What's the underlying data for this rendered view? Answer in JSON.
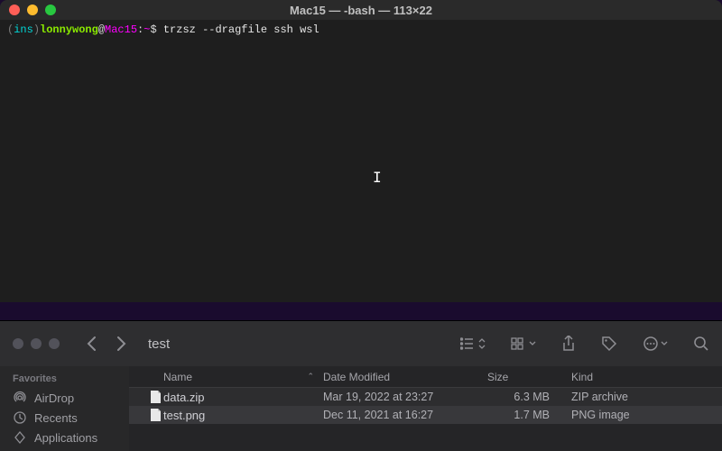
{
  "terminal": {
    "title": "Mac15 — -bash — 113×22",
    "prompt": {
      "ins": "ins",
      "user": "lonnywong",
      "at": "@",
      "host": "Mac15",
      "path": "~",
      "symbol": "$",
      "command": "trzsz --dragfile ssh wsl"
    }
  },
  "finder": {
    "folder_title": "test",
    "sidebar": {
      "header": "Favorites",
      "items": [
        {
          "label": "AirDrop",
          "icon": "airdrop-icon"
        },
        {
          "label": "Recents",
          "icon": "recents-icon"
        },
        {
          "label": "Applications",
          "icon": "applications-icon"
        }
      ]
    },
    "columns": {
      "name": "Name",
      "date": "Date Modified",
      "size": "Size",
      "kind": "Kind"
    },
    "files": [
      {
        "name": "data.zip",
        "date": "Mar 19, 2022 at 23:27",
        "size": "6.3 MB",
        "kind": "ZIP archive"
      },
      {
        "name": "test.png",
        "date": "Dec 11, 2021 at 16:27",
        "size": "1.7 MB",
        "kind": "PNG image"
      }
    ]
  }
}
